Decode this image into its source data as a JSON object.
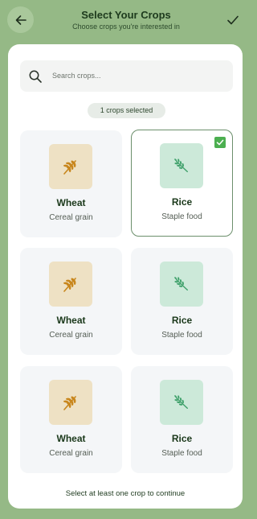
{
  "header": {
    "title": "Select Your Crops",
    "subtitle": "Choose crops you're interested in",
    "back_icon": "arrow-left-icon",
    "confirm_icon": "checkmark-icon"
  },
  "search": {
    "placeholder": "Search crops...",
    "value": "",
    "icon": "search-icon"
  },
  "selection": {
    "count_label": "1 crops selected"
  },
  "crops": [
    {
      "name": "Wheat",
      "description": "Cereal grain",
      "icon": "wheat-icon",
      "selected": false
    },
    {
      "name": "Rice",
      "description": "Staple food",
      "icon": "rice-icon",
      "selected": true
    },
    {
      "name": "Wheat",
      "description": "Cereal grain",
      "icon": "wheat-icon",
      "selected": false
    },
    {
      "name": "Rice",
      "description": "Staple food",
      "icon": "rice-icon",
      "selected": false
    },
    {
      "name": "Wheat",
      "description": "Cereal grain",
      "icon": "wheat-icon",
      "selected": false
    },
    {
      "name": "Rice",
      "description": "Staple food",
      "icon": "rice-icon",
      "selected": false
    }
  ],
  "footer": {
    "note": "Select at least one crop to continue"
  },
  "colors": {
    "background": "#95b986",
    "wheat_tile": "#eee1c4",
    "wheat_icon": "#c8861c",
    "rice_tile": "#cce9d9",
    "rice_icon": "#3ea06a",
    "checkbox": "#4caf50"
  }
}
